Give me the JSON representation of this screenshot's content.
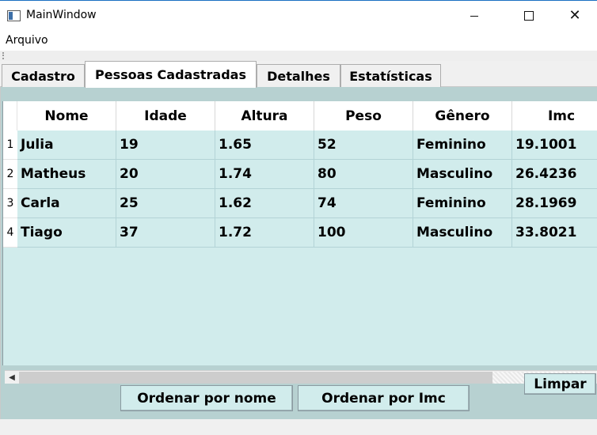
{
  "window": {
    "title": "MainWindow",
    "minimize_icon": "minimize-icon",
    "maximize_icon": "maximize-icon",
    "close_icon": "close-icon",
    "close_glyph": "✕"
  },
  "menu": {
    "items": [
      {
        "label": "Arquivo"
      }
    ]
  },
  "tabs": [
    {
      "label": "Cadastro",
      "active": false
    },
    {
      "label": "Pessoas Cadastradas",
      "active": true
    },
    {
      "label": "Detalhes",
      "active": false
    },
    {
      "label": "Estatísticas",
      "active": false
    }
  ],
  "table": {
    "columns": [
      "Nome",
      "Idade",
      "Altura",
      "Peso",
      "Gênero",
      "Imc"
    ],
    "rows": [
      {
        "num": "1",
        "cells": [
          "Julia",
          "19",
          "1.65",
          "52",
          "Feminino",
          "19.1001"
        ]
      },
      {
        "num": "2",
        "cells": [
          "Matheus",
          "20",
          "1.74",
          "80",
          "Masculino",
          "26.4236"
        ]
      },
      {
        "num": "3",
        "cells": [
          "Carla",
          "25",
          "1.62",
          "74",
          "Feminino",
          "28.1969"
        ]
      },
      {
        "num": "4",
        "cells": [
          "Tiago",
          "37",
          "1.72",
          "100",
          "Masculino",
          "33.8021"
        ]
      }
    ]
  },
  "scrollbar": {
    "left_arrow": "◀",
    "right_arrow": "▶"
  },
  "buttons": {
    "limpar": "Limpar",
    "sort_name": "Ordenar por nome",
    "sort_imc": "Ordenar por Imc"
  },
  "colors": {
    "grid_background": "#d1ecec",
    "panel_background": "#b7d1d1",
    "title_border": "#1b6fc2"
  }
}
